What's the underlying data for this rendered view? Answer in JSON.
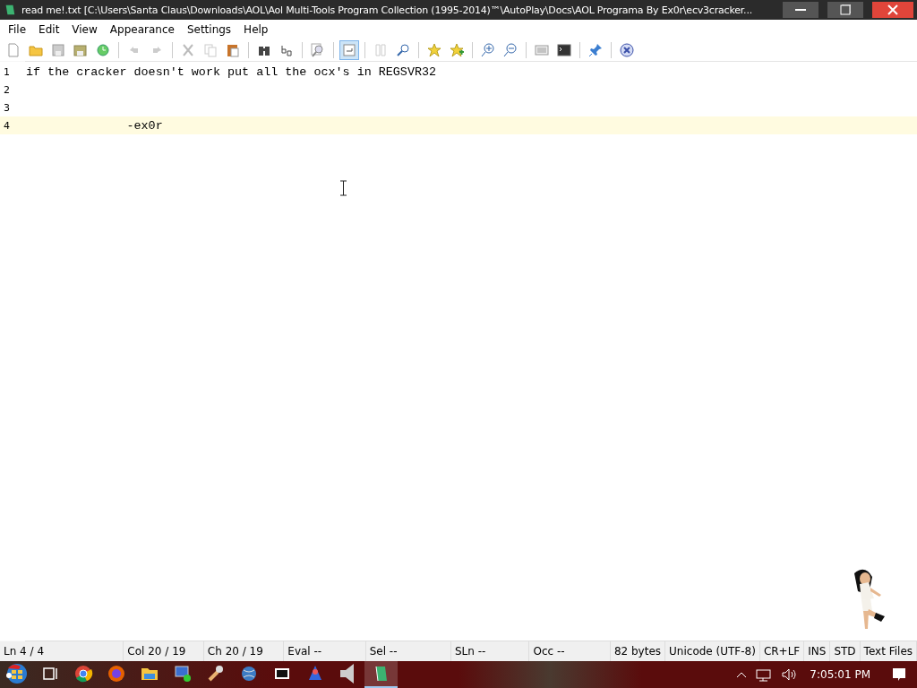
{
  "window": {
    "title": "read me!.txt [C:\\Users\\Santa Claus\\Downloads\\AOL\\Aol Multi-Tools Program Collection (1995-2014)™\\AutoPlay\\Docs\\AOL Programa By Ex0r\\ecv3cracker..."
  },
  "menu": [
    "File",
    "Edit",
    "View",
    "Appearance",
    "Settings",
    "Help"
  ],
  "toolbar": [
    {
      "kind": "new"
    },
    {
      "kind": "open"
    },
    {
      "kind": "save"
    },
    {
      "kind": "saveall"
    },
    {
      "kind": "reload"
    },
    {
      "kind": "sep"
    },
    {
      "kind": "undo"
    },
    {
      "kind": "redo"
    },
    {
      "kind": "sep"
    },
    {
      "kind": "cut"
    },
    {
      "kind": "copy"
    },
    {
      "kind": "paste"
    },
    {
      "kind": "sep"
    },
    {
      "kind": "find"
    },
    {
      "kind": "replace"
    },
    {
      "kind": "sep"
    },
    {
      "kind": "zoomdoc"
    },
    {
      "kind": "sep"
    },
    {
      "kind": "wrap",
      "selected": true
    },
    {
      "kind": "sep"
    },
    {
      "kind": "columns"
    },
    {
      "kind": "lens"
    },
    {
      "kind": "sep"
    },
    {
      "kind": "star"
    },
    {
      "kind": "staradd"
    },
    {
      "kind": "sep"
    },
    {
      "kind": "zoomin"
    },
    {
      "kind": "zoomout"
    },
    {
      "kind": "sep"
    },
    {
      "kind": "list"
    },
    {
      "kind": "console"
    },
    {
      "kind": "sep"
    },
    {
      "kind": "pin"
    },
    {
      "kind": "sep"
    },
    {
      "kind": "close"
    }
  ],
  "editor": {
    "lines": [
      {
        "number": "1",
        "text": "if the cracker doesn't work put all the ocx's in REGSVR32",
        "current": false
      },
      {
        "number": "2",
        "current": false
      },
      {
        "number": "3",
        "current": false
      },
      {
        "number": "4",
        "text": "\t\t-ex0r",
        "current": true
      }
    ]
  },
  "status_bar": [
    "Ln 4 / 4",
    "Col 20 / 19",
    "Ch 20 / 19",
    "Eval --",
    "Sel --",
    "SLn --",
    "Occ --",
    "82 bytes",
    "Unicode (UTF-8)",
    "CR+LF",
    "INS",
    "STD",
    "Text Files"
  ],
  "taskbar": {
    "apps": [
      {
        "kind": "start"
      },
      {
        "kind": "taskview"
      },
      {
        "kind": "chrome"
      },
      {
        "kind": "firefox"
      },
      {
        "kind": "folder"
      },
      {
        "kind": "monitor"
      },
      {
        "kind": "wrench"
      },
      {
        "kind": "globe"
      },
      {
        "kind": "zip"
      },
      {
        "kind": "people"
      },
      {
        "kind": "speaker"
      },
      {
        "kind": "notepad",
        "selected": true
      }
    ],
    "clock": "7:05:01 PM"
  }
}
